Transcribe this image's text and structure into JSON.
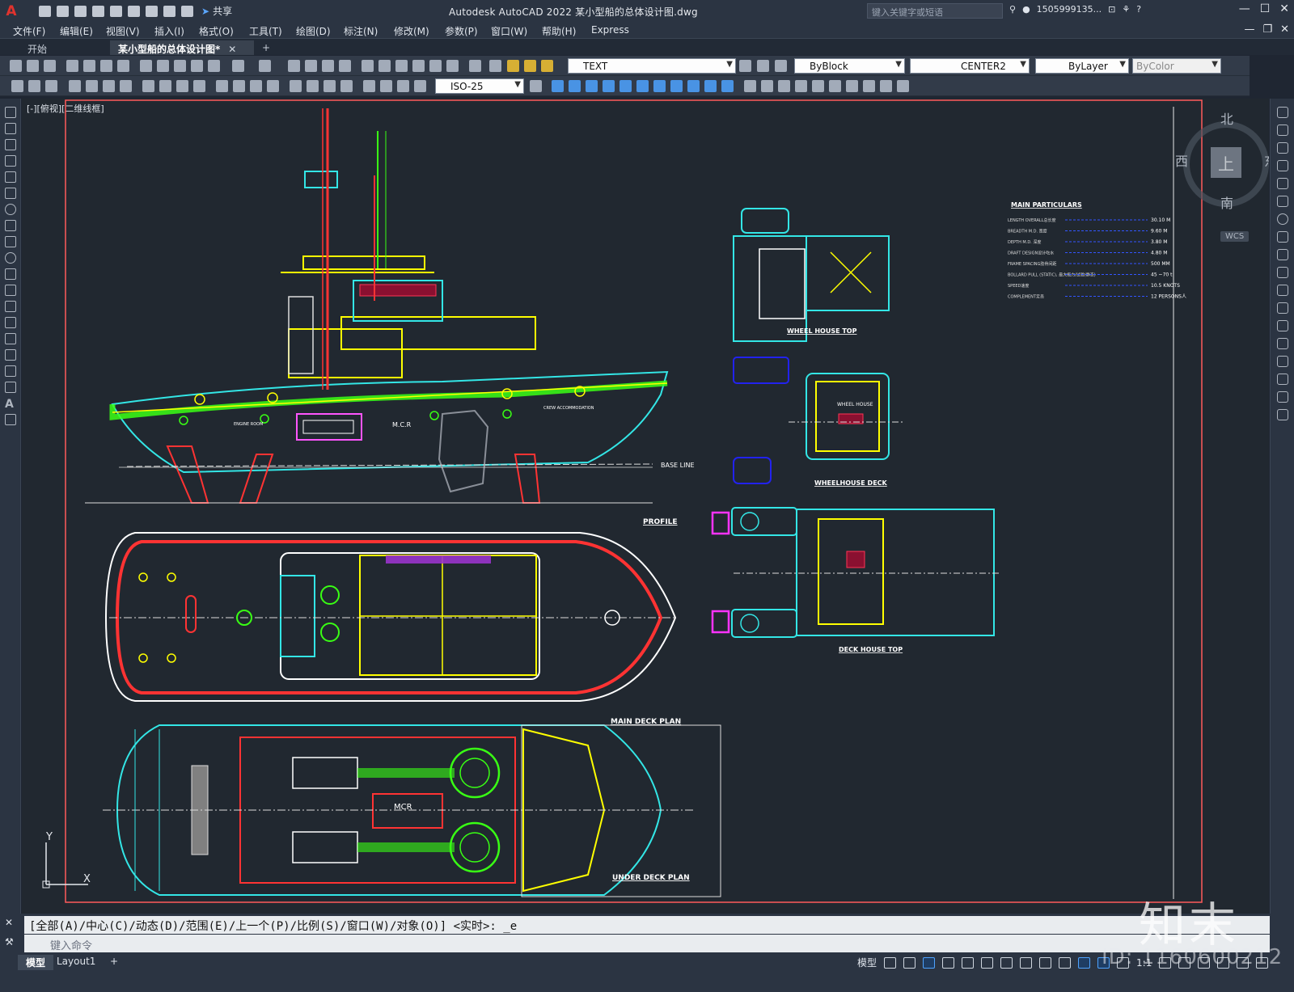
{
  "app": {
    "logo": "A",
    "title": "Autodesk AutoCAD 2022    某小型船的总体设计图.dwg",
    "share_label": "共享",
    "search_placeholder": "键入关键字或短语",
    "user": "1505999135...",
    "help_icon": "?"
  },
  "menu": {
    "items": [
      "文件(F)",
      "编辑(E)",
      "视图(V)",
      "插入(I)",
      "格式(O)",
      "工具(T)",
      "绘图(D)",
      "标注(N)",
      "修改(M)",
      "参数(P)",
      "窗口(W)",
      "帮助(H)",
      "Express"
    ]
  },
  "tabs": [
    {
      "label": "开始"
    },
    {
      "label": "某小型船的总体设计图*"
    }
  ],
  "toolbar": {
    "text_style": "TEXT",
    "dim_style": "ISO-25",
    "layer_color": "ByBlock",
    "linetype": "CENTER2",
    "lineweight": "ByLayer",
    "plot_style": "ByColor"
  },
  "viewport": {
    "label": "[-][俯视][二维线框]",
    "compass": {
      "north": "北",
      "south": "南",
      "east": "东",
      "west": "西",
      "top": "上",
      "wcs": "WCS"
    },
    "ucs": {
      "x": "X",
      "y": "Y"
    }
  },
  "drawing": {
    "titles": {
      "profile": "PROFILE",
      "main_deck_plan": "MAIN DECK PLAN",
      "under_deck_plan": "UNDER DECK PLAN",
      "wheel_house_top": "WHEEL HOUSE TOP",
      "wheelhouse_deck": "WHEELHOUSE DECK",
      "deck_house_top": "DECK HOUSE TOP",
      "base_line": "BASE LINE",
      "mcr": "M.C.R",
      "mcr_under": "MCR",
      "wheel_house": "WHEEL HOUSE",
      "engine_room": "ENGINE ROOM",
      "crew_accommodation": "CREW ACCOMMODATION"
    },
    "particulars": {
      "heading": "MAIN PARTICULARS",
      "rows": [
        {
          "label": "LENGTH OVERALL总长度",
          "value": "30.10 M"
        },
        {
          "label": "BREADTH M.D. 宽度",
          "value": "9.60 M"
        },
        {
          "label": "DEPTH M.D. 深度",
          "value": "3.80 M"
        },
        {
          "label": "DRAFT DESIGN设计吃水",
          "value": "4.80 M"
        },
        {
          "label": "FRAME SPACING肋骨间距",
          "value": "500 MM"
        },
        {
          "label": "BOLLARD PULL (STATIC), 最大拖力/试验(静态)",
          "value": "45 ~70 t"
        },
        {
          "label": "SPEED速度",
          "value": "10.5 KNOTS"
        },
        {
          "label": "COMPLEMENT定员",
          "value": "12 PERSONS人"
        }
      ]
    }
  },
  "command": {
    "history": "[全部(A)/中心(C)/动态(D)/范围(E)/上一个(P)/比例(S)/窗口(W)/对象(O)] <实时>: _e",
    "placeholder": "键入命令"
  },
  "status": {
    "tabs": [
      "模型",
      "Layout1"
    ],
    "model_label": "模型",
    "scale": "1:1"
  },
  "watermark": {
    "id": "ID: 1160600212",
    "logo": "知末"
  }
}
